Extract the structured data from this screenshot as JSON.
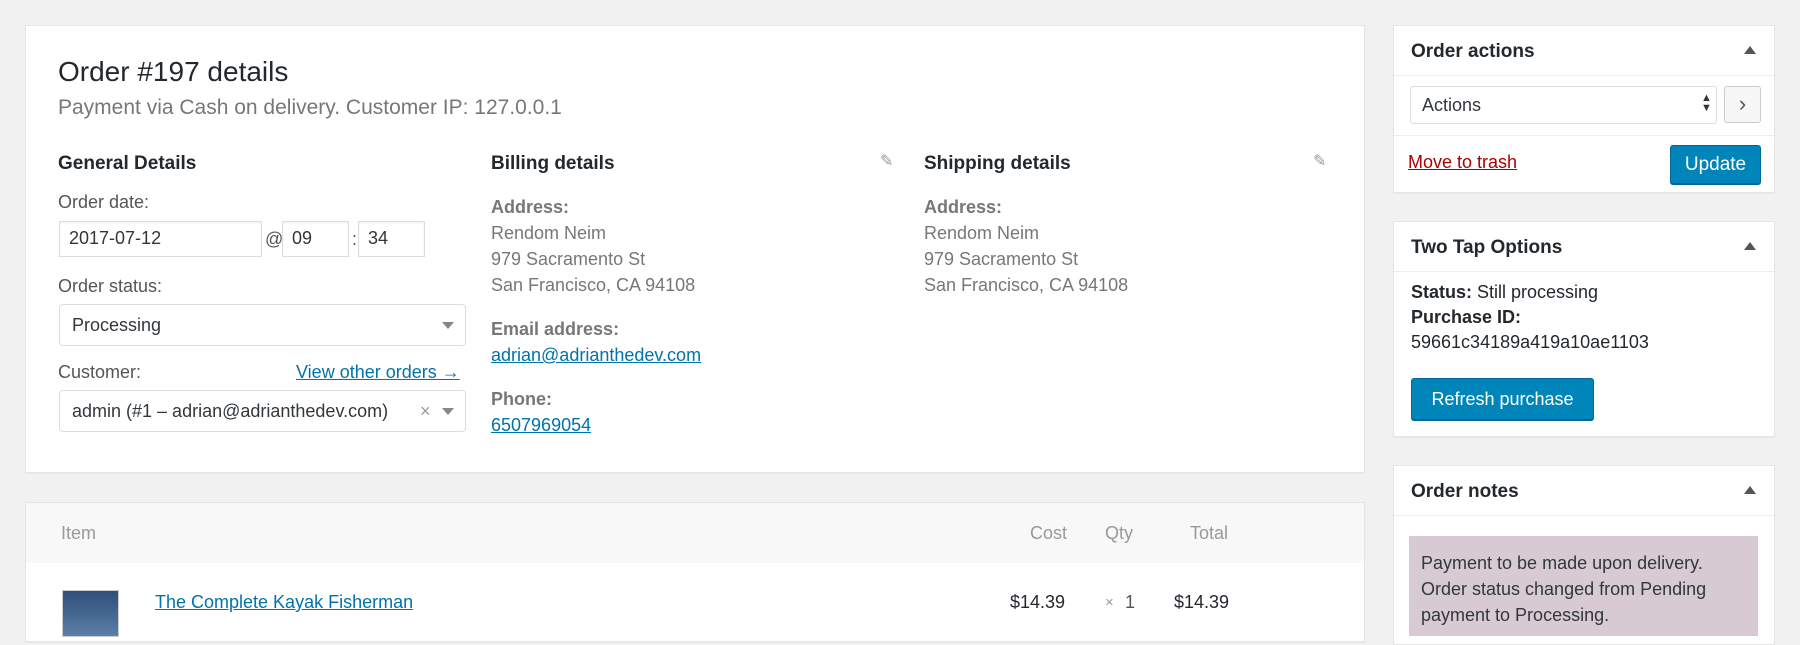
{
  "order": {
    "title": "Order #197 details",
    "subtitle": "Payment via Cash on delivery. Customer IP: 127.0.0.1"
  },
  "general": {
    "heading": "General Details",
    "order_date_label": "Order date:",
    "order_date": "2017-07-12",
    "at": "@",
    "hour": "09",
    "colon": ":",
    "minute": "34",
    "status_label": "Order status:",
    "status": "Processing",
    "customer_label": "Customer:",
    "view_orders": "View other orders →",
    "customer": "admin (#1 – adrian@adrianthedev.com)",
    "clear": "×"
  },
  "billing": {
    "heading": "Billing details",
    "address_label": "Address:",
    "address_lines": [
      "Rendom Neim",
      "979 Sacramento St",
      "San Francisco, CA 94108"
    ],
    "email_label": "Email address:",
    "email": "adrian@adrianthedev.com",
    "phone_label": "Phone:",
    "phone": "6507969054"
  },
  "shipping": {
    "heading": "Shipping details",
    "address_label": "Address:",
    "address_lines": [
      "Rendom Neim",
      "979 Sacramento St",
      "San Francisco, CA 94108"
    ]
  },
  "items": {
    "headers": {
      "item": "Item",
      "cost": "Cost",
      "qty": "Qty",
      "total": "Total"
    },
    "rows": [
      {
        "name": "The Complete Kayak Fisherman",
        "cost": "$14.39",
        "qty_x": "×",
        "qty": "1",
        "total": "$14.39"
      }
    ]
  },
  "order_actions": {
    "heading": "Order actions",
    "select": "Actions",
    "go": "›",
    "trash": "Move to trash",
    "update": "Update"
  },
  "two_tap": {
    "heading": "Two Tap Options",
    "status_label": "Status:",
    "status_value": " Still processing",
    "purchase_label": "Purchase ID:",
    "purchase_id": "59661c34189a419a10ae1103",
    "refresh": "Refresh purchase"
  },
  "notes": {
    "heading": "Order notes",
    "note": "Payment to be made upon delivery. Order status changed from Pending payment to Processing."
  },
  "colors": {
    "primary": "#0085ba",
    "link": "#0073aa",
    "trash": "#a00",
    "note_bg": "#d7cad2"
  }
}
